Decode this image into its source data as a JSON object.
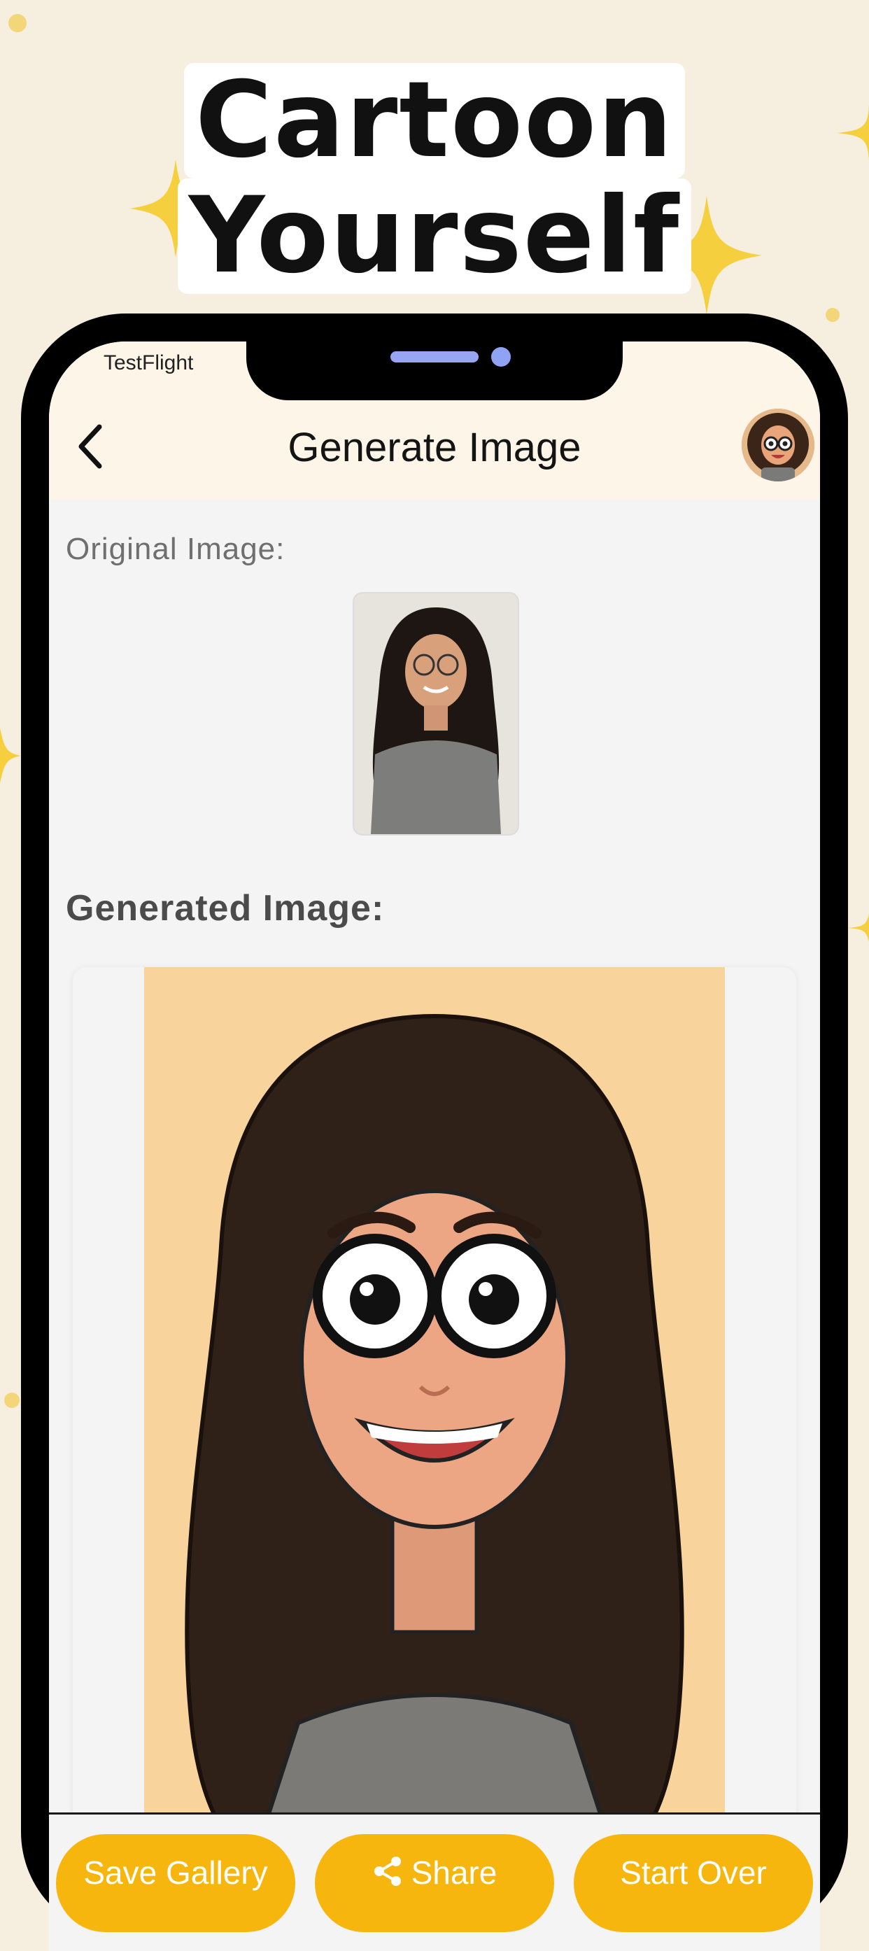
{
  "headline": {
    "line1": "Cartoon",
    "line2": "Yourself"
  },
  "status": {
    "carrier": "TestFlight"
  },
  "header": {
    "title": "Generate Image",
    "back_icon": "chevron-left-icon",
    "avatar": "cartoon-avatar"
  },
  "content": {
    "original_label": "Original Image:",
    "generated_label": "Generated Image:"
  },
  "actions": [
    {
      "label": "Save Gallery"
    },
    {
      "label": "Share",
      "icon": "share-icon"
    },
    {
      "label": "Start Over"
    }
  ],
  "colors": {
    "accent": "#f7b60e",
    "background": "#f6efdf",
    "header_bg": "#fdf5e8",
    "notch_accent": "#97a6f2"
  }
}
